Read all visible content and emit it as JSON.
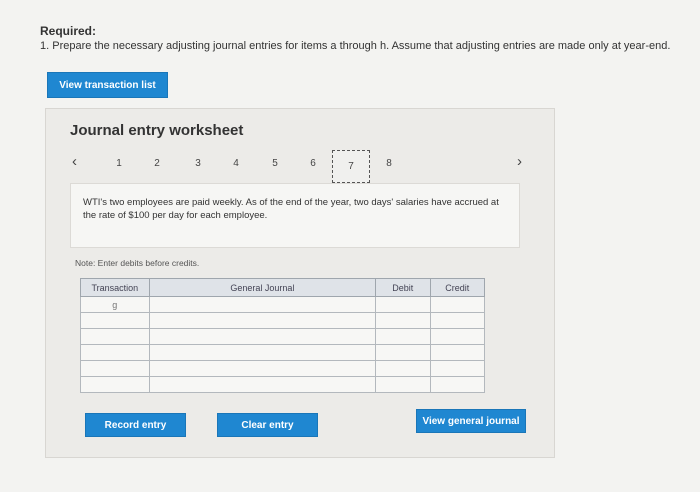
{
  "header": {
    "required_title": "Required:",
    "instruction": "1. Prepare the necessary adjusting journal entries for items a through h. Assume that adjusting entries are made only at year-end."
  },
  "buttons": {
    "view_transaction_list": "View transaction list",
    "record_entry": "Record entry",
    "clear_entry": "Clear entry",
    "view_general_journal": "View general journal"
  },
  "worksheet": {
    "title": "Journal entry worksheet",
    "nav_prev_icon": "‹",
    "nav_next_icon": "›",
    "steps": [
      "1",
      "2",
      "3",
      "4",
      "5",
      "6",
      "7",
      "8"
    ],
    "active_step": "7",
    "description": "WTI's two employees are paid weekly. As of the end of the year, two days' salaries have accrued at the rate of $100 per day for each employee.",
    "note": "Note: Enter debits before credits."
  },
  "journal_table": {
    "headers": {
      "transaction": "Transaction",
      "general_journal": "General Journal",
      "debit": "Debit",
      "credit": "Credit"
    },
    "transaction_value": "g"
  },
  "colors": {
    "primary_button": "#1f87d1",
    "panel_bg": "#ecebe8",
    "header_bg": "#dfe3e8"
  }
}
